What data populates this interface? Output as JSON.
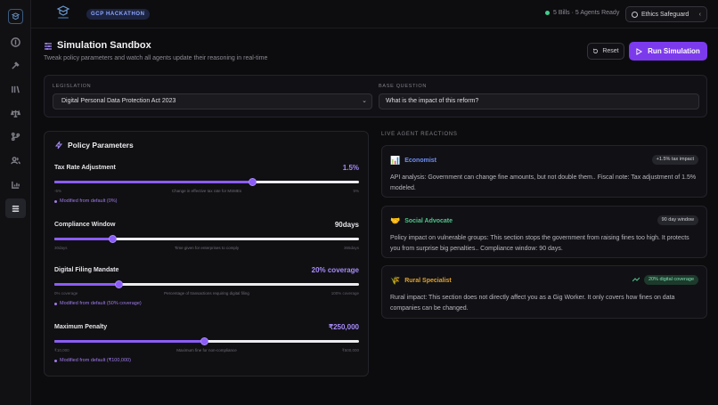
{
  "header": {
    "hackathon_badge": "GCP HACKATHON",
    "status_text": "5 Bills · 5 Agents Ready",
    "ethics_label": "Ethics Safeguard"
  },
  "page": {
    "title": "Simulation Sandbox",
    "subtitle": "Tweak policy parameters and watch all agents update their reasoning in real-time",
    "reset_label": "Reset",
    "run_label": "Run Simulation"
  },
  "legislation": {
    "label": "LEGISLATION",
    "selected": "Digital Personal Data Protection Act 2023",
    "question_label": "BASE QUESTION",
    "question_value": "What is the impact of this reform?"
  },
  "policy": {
    "title": "Policy Parameters",
    "params": [
      {
        "name": "Tax Rate Adjustment",
        "value": "1.5%",
        "value_color": "#a78bfa",
        "fraction": 0.65,
        "min": "-5%",
        "desc": "Change in effective tax rate for MSMEs",
        "max": "5%",
        "modified": "Modified from default (0%)"
      },
      {
        "name": "Compliance Window",
        "value": "90days",
        "value_color": "#e4e4e8",
        "fraction": 0.19,
        "min": "30days",
        "desc": "Time given for enterprises to comply",
        "max": "365days",
        "modified": ""
      },
      {
        "name": "Digital Filing Mandate",
        "value": "20% coverage",
        "value_color": "#a78bfa",
        "fraction": 0.21,
        "min": "0% coverage",
        "desc": "Percentage of transactions requiring digital filing",
        "max": "100% coverage",
        "modified": "Modified from default (50% coverage)"
      },
      {
        "name": "Maximum Penalty",
        "value": "₹250,000",
        "value_color": "#a78bfa",
        "fraction": 0.49,
        "min": "₹10,000",
        "desc": "Maximum fine for non-compliance",
        "max": "₹500,000",
        "modified": "Modified from default (₹100,000)"
      }
    ]
  },
  "agents": {
    "label": "LIVE AGENT REACTIONS",
    "items": [
      {
        "icon": "📊",
        "name": "Economist",
        "color": "#6f8ff7",
        "tag": "+1.5% tax impact",
        "text": "API analysis: Government can change fine amounts, but not double them.. Fiscal note: Tax adjustment of 1.5% modeled."
      },
      {
        "icon": "🤝",
        "name": "Social Advocate",
        "color": "#4fc48a",
        "tag": "90 day window",
        "text": "Policy impact on vulnerable groups: This section stops the government from raising fines too high. It protects you from surprise big penalties.. Compliance window: 90 days."
      },
      {
        "icon": "🌾",
        "name": "Rural Specialist",
        "color": "#e0a12f",
        "tag": "20% digital coverage",
        "text": "Rural impact: This section does not directly affect you as a Gig Worker. It only covers how fines on data companies can be changed."
      }
    ]
  }
}
